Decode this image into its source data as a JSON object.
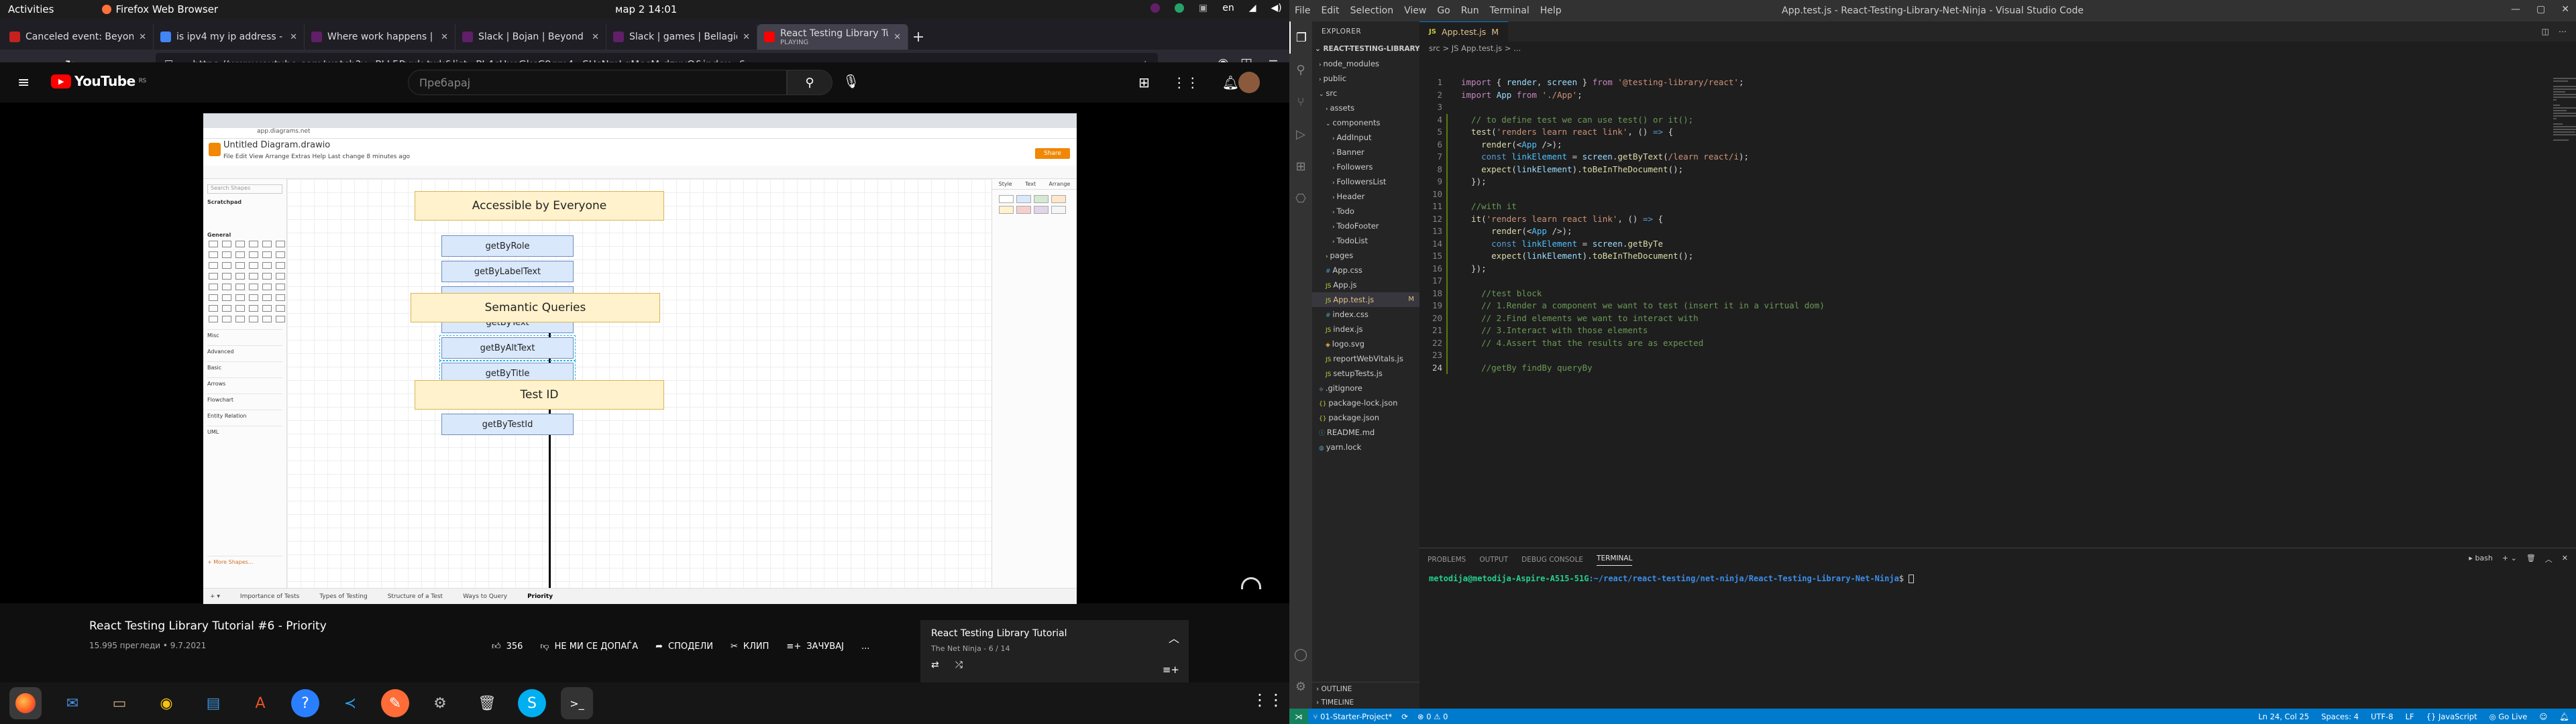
{
  "topbar": {
    "activities": "Activities",
    "app": "Firefox Web Browser",
    "clock": "мар 2  14:01",
    "lang": "en"
  },
  "firefox": {
    "tabs": [
      {
        "label": "Canceled event: Beyond",
        "color": "#c5221f"
      },
      {
        "label": "is ipv4 my ip address - Пр",
        "color": "#4285f4"
      },
      {
        "label": "Where work happens | Sl",
        "color": "#611f69"
      },
      {
        "label": "Slack | Bojan | Beyond Bu",
        "color": "#611f69"
      },
      {
        "label": "Slack | games | Bellagio |",
        "color": "#611f69"
      },
      {
        "label": "React Testing Library Tut",
        "sub": "PLAYING",
        "color": "#ff0000"
      }
    ],
    "url": "https://www.youtube.com/watch?v=PLL5Pvuk-twk&list=PL4cUxeGkcC9gm4_-SUsNmLqMosM-dzuvQ&index=6"
  },
  "youtube": {
    "logo": "YouTube",
    "logo_sup": "RS",
    "search_placeholder": "Пребарај",
    "video_title": "React Testing Library Tutorial #6 - Priority",
    "video_meta": "15.995 прегледи • 9.7.2021",
    "actions": {
      "likes": "356",
      "dislike": "НЕ МИ СЕ ДОПАЃА",
      "share": "СПОДЕЛИ",
      "clip": "КЛИП",
      "save": "ЗАЧУВАЈ",
      "more": "..."
    },
    "playlist": {
      "title": "React Testing Library Tutorial",
      "sub": "The Net Ninja - 6 / 14"
    }
  },
  "video_frame": {
    "doc_title": "Untitled Diagram.drawio",
    "menu": "File  Edit  View  Arrange  Extras  Help    Last change 8 minutes ago",
    "share": "Share",
    "left_panel": {
      "search": "Search Shapes",
      "scratchpad": "Scratchpad",
      "general": "General",
      "categories": [
        "Misc",
        "Advanced",
        "Basic",
        "Arrows",
        "Flowchart",
        "Entity Relation",
        "UML"
      ],
      "more": "+ More Shapes..."
    },
    "right_panel": {
      "tabs": [
        "Style",
        "Text",
        "Arrange"
      ]
    },
    "pages": [
      "Importance of Tests",
      "Types of Testing",
      "Structure of a Test",
      "Ways to Query",
      "Priority"
    ],
    "diagram": {
      "groups": [
        {
          "title": "Accessible by Everyone",
          "items": [
            "getByRole",
            "getByLabelText",
            "getByPlaceholderText",
            "getByText"
          ]
        },
        {
          "title": "Semantic Queries",
          "items": [
            "getByAltText",
            "getByTitle"
          ]
        },
        {
          "title": "Test ID",
          "items": [
            "getByTestId"
          ]
        }
      ]
    }
  },
  "vscode": {
    "window_title": "App.test.js - React-Testing-Library-Net-Ninja - Visual Studio Code",
    "menu": [
      "File",
      "Edit",
      "Selection",
      "View",
      "Go",
      "Run",
      "Terminal",
      "Help"
    ],
    "explorer_title": "EXPLORER",
    "project": "REACT-TESTING-LIBRARY-...",
    "tree": [
      {
        "label": "node_modules",
        "depth": 1,
        "kind": "folder-closed"
      },
      {
        "label": "public",
        "depth": 1,
        "kind": "folder-closed"
      },
      {
        "label": "src",
        "depth": 1,
        "kind": "folder-open"
      },
      {
        "label": "assets",
        "depth": 2,
        "kind": "folder-closed"
      },
      {
        "label": "components",
        "depth": 2,
        "kind": "folder-open"
      },
      {
        "label": "AddInput",
        "depth": 3,
        "kind": "folder-closed"
      },
      {
        "label": "Banner",
        "depth": 3,
        "kind": "folder-closed"
      },
      {
        "label": "Followers",
        "depth": 3,
        "kind": "folder-closed"
      },
      {
        "label": "FollowersList",
        "depth": 3,
        "kind": "folder-closed"
      },
      {
        "label": "Header",
        "depth": 3,
        "kind": "folder-closed"
      },
      {
        "label": "Todo",
        "depth": 3,
        "kind": "folder-closed"
      },
      {
        "label": "TodoFooter",
        "depth": 3,
        "kind": "folder-closed"
      },
      {
        "label": "TodoList",
        "depth": 3,
        "kind": "folder-closed"
      },
      {
        "label": "pages",
        "depth": 2,
        "kind": "folder-closed"
      },
      {
        "label": "App.css",
        "depth": 2,
        "kind": "css"
      },
      {
        "label": "App.js",
        "depth": 2,
        "kind": "js"
      },
      {
        "label": "App.test.js",
        "depth": 2,
        "kind": "js",
        "badge": "M",
        "selected": true
      },
      {
        "label": "index.css",
        "depth": 2,
        "kind": "css"
      },
      {
        "label": "index.js",
        "depth": 2,
        "kind": "js"
      },
      {
        "label": "logo.svg",
        "depth": 2,
        "kind": "svg"
      },
      {
        "label": "reportWebVitals.js",
        "depth": 2,
        "kind": "js"
      },
      {
        "label": "setupTests.js",
        "depth": 2,
        "kind": "js"
      },
      {
        "label": ".gitignore",
        "depth": 1,
        "kind": "git"
      },
      {
        "label": "package-lock.json",
        "depth": 1,
        "kind": "json"
      },
      {
        "label": "package.json",
        "depth": 1,
        "kind": "json"
      },
      {
        "label": "README.md",
        "depth": 1,
        "kind": "md"
      },
      {
        "label": "yarn.lock",
        "depth": 1,
        "kind": "yarn"
      }
    ],
    "outline": "OUTLINE",
    "timeline": "TIMELINE",
    "tab": "App.test.js",
    "tab_badge": "M",
    "breadcrumb": "src > JS App.test.js > ...",
    "panel_tabs": [
      "PROBLEMS",
      "OUTPUT",
      "DEBUG CONSOLE",
      "TERMINAL"
    ],
    "terminal_shell": "bash",
    "terminal_user": "metodija@metodija-Aspire-A515-51G",
    "terminal_path": ":~/react/react-testing/net-ninja/React-Testing-Library-Net-Ninja",
    "terminal_prompt": "$ ",
    "status": {
      "branch": "01-Starter-Project*",
      "errors": "⊗ 0  ⚠ 0",
      "position": "Ln 24, Col 25",
      "spaces": "Spaces: 4",
      "encoding": "UTF-8",
      "eol": "LF",
      "language": "{} JavaScript",
      "golive": "Go Live"
    }
  }
}
